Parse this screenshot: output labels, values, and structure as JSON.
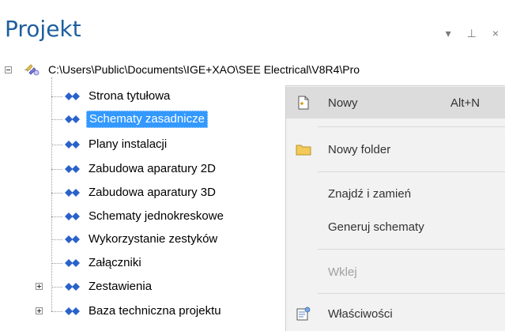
{
  "panel": {
    "title": "Projekt",
    "pin_glyph": "▾",
    "dock_glyph": "⊥",
    "close_glyph": "×"
  },
  "tree": {
    "root_path": "C:\\Users\\Public\\Documents\\IGE+XAO\\SEE Electrical\\V8R4\\Pro",
    "items": [
      {
        "label": "Strona tytułowa"
      },
      {
        "label": "Schematy zasadnicze"
      },
      {
        "label": "Plany instalacji"
      },
      {
        "label": "Zabudowa aparatury 2D"
      },
      {
        "label": "Zabudowa aparatury 3D"
      },
      {
        "label": "Schematy jednokreskowe"
      },
      {
        "label": "Wykorzystanie zestyków"
      },
      {
        "label": "Załączniki"
      },
      {
        "label": "Zestawienia"
      },
      {
        "label": "Baza techniczna projektu"
      }
    ]
  },
  "context_menu": {
    "items": [
      {
        "label": "Nowy",
        "shortcut": "Alt+N"
      },
      {
        "label": "Nowy folder"
      },
      {
        "label": "Znajdź i zamień"
      },
      {
        "label": "Generuj schematy"
      },
      {
        "label": "Wklej"
      },
      {
        "label": "Właściwości"
      }
    ]
  },
  "colors": {
    "title": "#1e5f9f",
    "selection": "#3399ff",
    "menu_bg": "#f2f2f2",
    "menu_hover": "#dcdcdc"
  }
}
